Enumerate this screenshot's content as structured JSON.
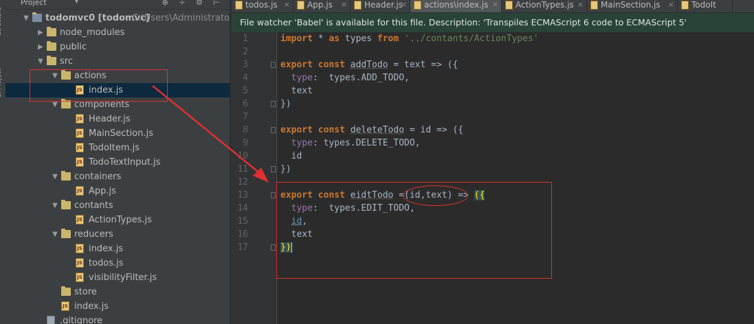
{
  "side_tabs": [
    "Structure",
    "1: Project"
  ],
  "project_panel": {
    "title": "Project",
    "tree": [
      {
        "label": "todomvc0 [todomvc]",
        "path": "C:\\Users\\Administrator\\De",
        "kind": "root",
        "expanded": true,
        "indent": 0
      },
      {
        "label": "node_modules",
        "kind": "folder",
        "expanded": false,
        "indent": 1
      },
      {
        "label": "public",
        "kind": "folder",
        "expanded": false,
        "indent": 1
      },
      {
        "label": "src",
        "kind": "folder",
        "expanded": true,
        "indent": 1
      },
      {
        "label": "actions",
        "kind": "folder",
        "expanded": true,
        "indent": 2
      },
      {
        "label": "index.js",
        "kind": "js",
        "indent": 3,
        "selected": true
      },
      {
        "label": "components",
        "kind": "folder",
        "expanded": true,
        "indent": 2
      },
      {
        "label": "Header.js",
        "kind": "js",
        "indent": 3
      },
      {
        "label": "MainSection.js",
        "kind": "js",
        "indent": 3
      },
      {
        "label": "TodoItem.js",
        "kind": "js",
        "indent": 3
      },
      {
        "label": "TodoTextInput.js",
        "kind": "js",
        "indent": 3
      },
      {
        "label": "containers",
        "kind": "folder",
        "expanded": true,
        "indent": 2
      },
      {
        "label": "App.js",
        "kind": "js",
        "indent": 3
      },
      {
        "label": "contants",
        "kind": "folder",
        "expanded": true,
        "indent": 2
      },
      {
        "label": "ActionTypes.js",
        "kind": "js",
        "indent": 3
      },
      {
        "label": "reducers",
        "kind": "folder",
        "expanded": true,
        "indent": 2
      },
      {
        "label": "index.js",
        "kind": "js",
        "indent": 3
      },
      {
        "label": "todos.js",
        "kind": "js",
        "indent": 3
      },
      {
        "label": "visibilityFilter.js",
        "kind": "js",
        "indent": 3
      },
      {
        "label": "store",
        "kind": "folder",
        "expanded": false,
        "indent": 2,
        "no_arrow": true
      },
      {
        "label": "index.js",
        "kind": "js",
        "indent": 2
      },
      {
        "label": ".gitignore",
        "kind": "file",
        "indent": 1
      }
    ]
  },
  "tabs": [
    {
      "label": "todos.js",
      "active": false
    },
    {
      "label": "App.js",
      "active": false
    },
    {
      "label": "Header.js",
      "active": false
    },
    {
      "label": "actions\\index.js",
      "active": true
    },
    {
      "label": "ActionTypes.js",
      "active": false
    },
    {
      "label": "MainSection.js",
      "active": false
    },
    {
      "label": "TodoIt",
      "active": false
    }
  ],
  "notification": "File watcher 'Babel' is available for this file. Description: 'Transpiles ECMAScript 6 code to ECMAScript 5'",
  "editor": {
    "line_numbers": [
      "1",
      "2",
      "3",
      "4",
      "5",
      "6",
      "7",
      "8",
      "9",
      "10",
      "11",
      "12",
      "13",
      "14",
      "15",
      "16",
      "17"
    ],
    "lines": [
      [
        [
          "kw",
          "import"
        ],
        [
          "pm",
          " * "
        ],
        [
          "kw",
          "as"
        ],
        [
          "pm",
          " types "
        ],
        [
          "kw",
          "from"
        ],
        [
          "pm",
          " "
        ],
        [
          "str",
          "'../contants/ActionTypes'"
        ]
      ],
      [],
      [
        [
          "kw",
          "export const "
        ],
        [
          "fn",
          "addTodo"
        ],
        [
          "pm",
          " = text => ({"
        ]
      ],
      [
        [
          "pm",
          "  "
        ],
        [
          "prop",
          "type"
        ],
        [
          "pm",
          ":  types.ADD_TODO,"
        ]
      ],
      [
        [
          "pm",
          "  text"
        ]
      ],
      [
        [
          "pm",
          "})"
        ]
      ],
      [],
      [
        [
          "kw",
          "export const "
        ],
        [
          "fn",
          "deleteTodo"
        ],
        [
          "pm",
          " = id => ({"
        ]
      ],
      [
        [
          "pm",
          "  "
        ],
        [
          "prop",
          "type"
        ],
        [
          "pm",
          ": types.DELETE_TODO,"
        ]
      ],
      [
        [
          "pm",
          "  id"
        ]
      ],
      [
        [
          "pm",
          "})"
        ]
      ],
      [],
      [
        [
          "kw",
          "export const "
        ],
        [
          "fn",
          "eidtTodo"
        ],
        [
          "pm",
          " =(id,text) => "
        ],
        [
          "hl",
          "({"
        ]
      ],
      [
        [
          "pm",
          "  "
        ],
        [
          "prop",
          "type"
        ],
        [
          "pm",
          ":  types.EDIT_TODO,"
        ]
      ],
      [
        [
          "pm",
          "  "
        ],
        [
          "link",
          "id"
        ],
        [
          "pm",
          ","
        ]
      ],
      [
        [
          "pm",
          "  text"
        ]
      ],
      [
        [
          "hl",
          "})"
        ]
      ]
    ]
  },
  "colors": {
    "annotation_red": "#e03030",
    "notice_bg": "#294436",
    "keyword": "#cc7832",
    "string": "#6a8759",
    "property": "#9876aa"
  }
}
